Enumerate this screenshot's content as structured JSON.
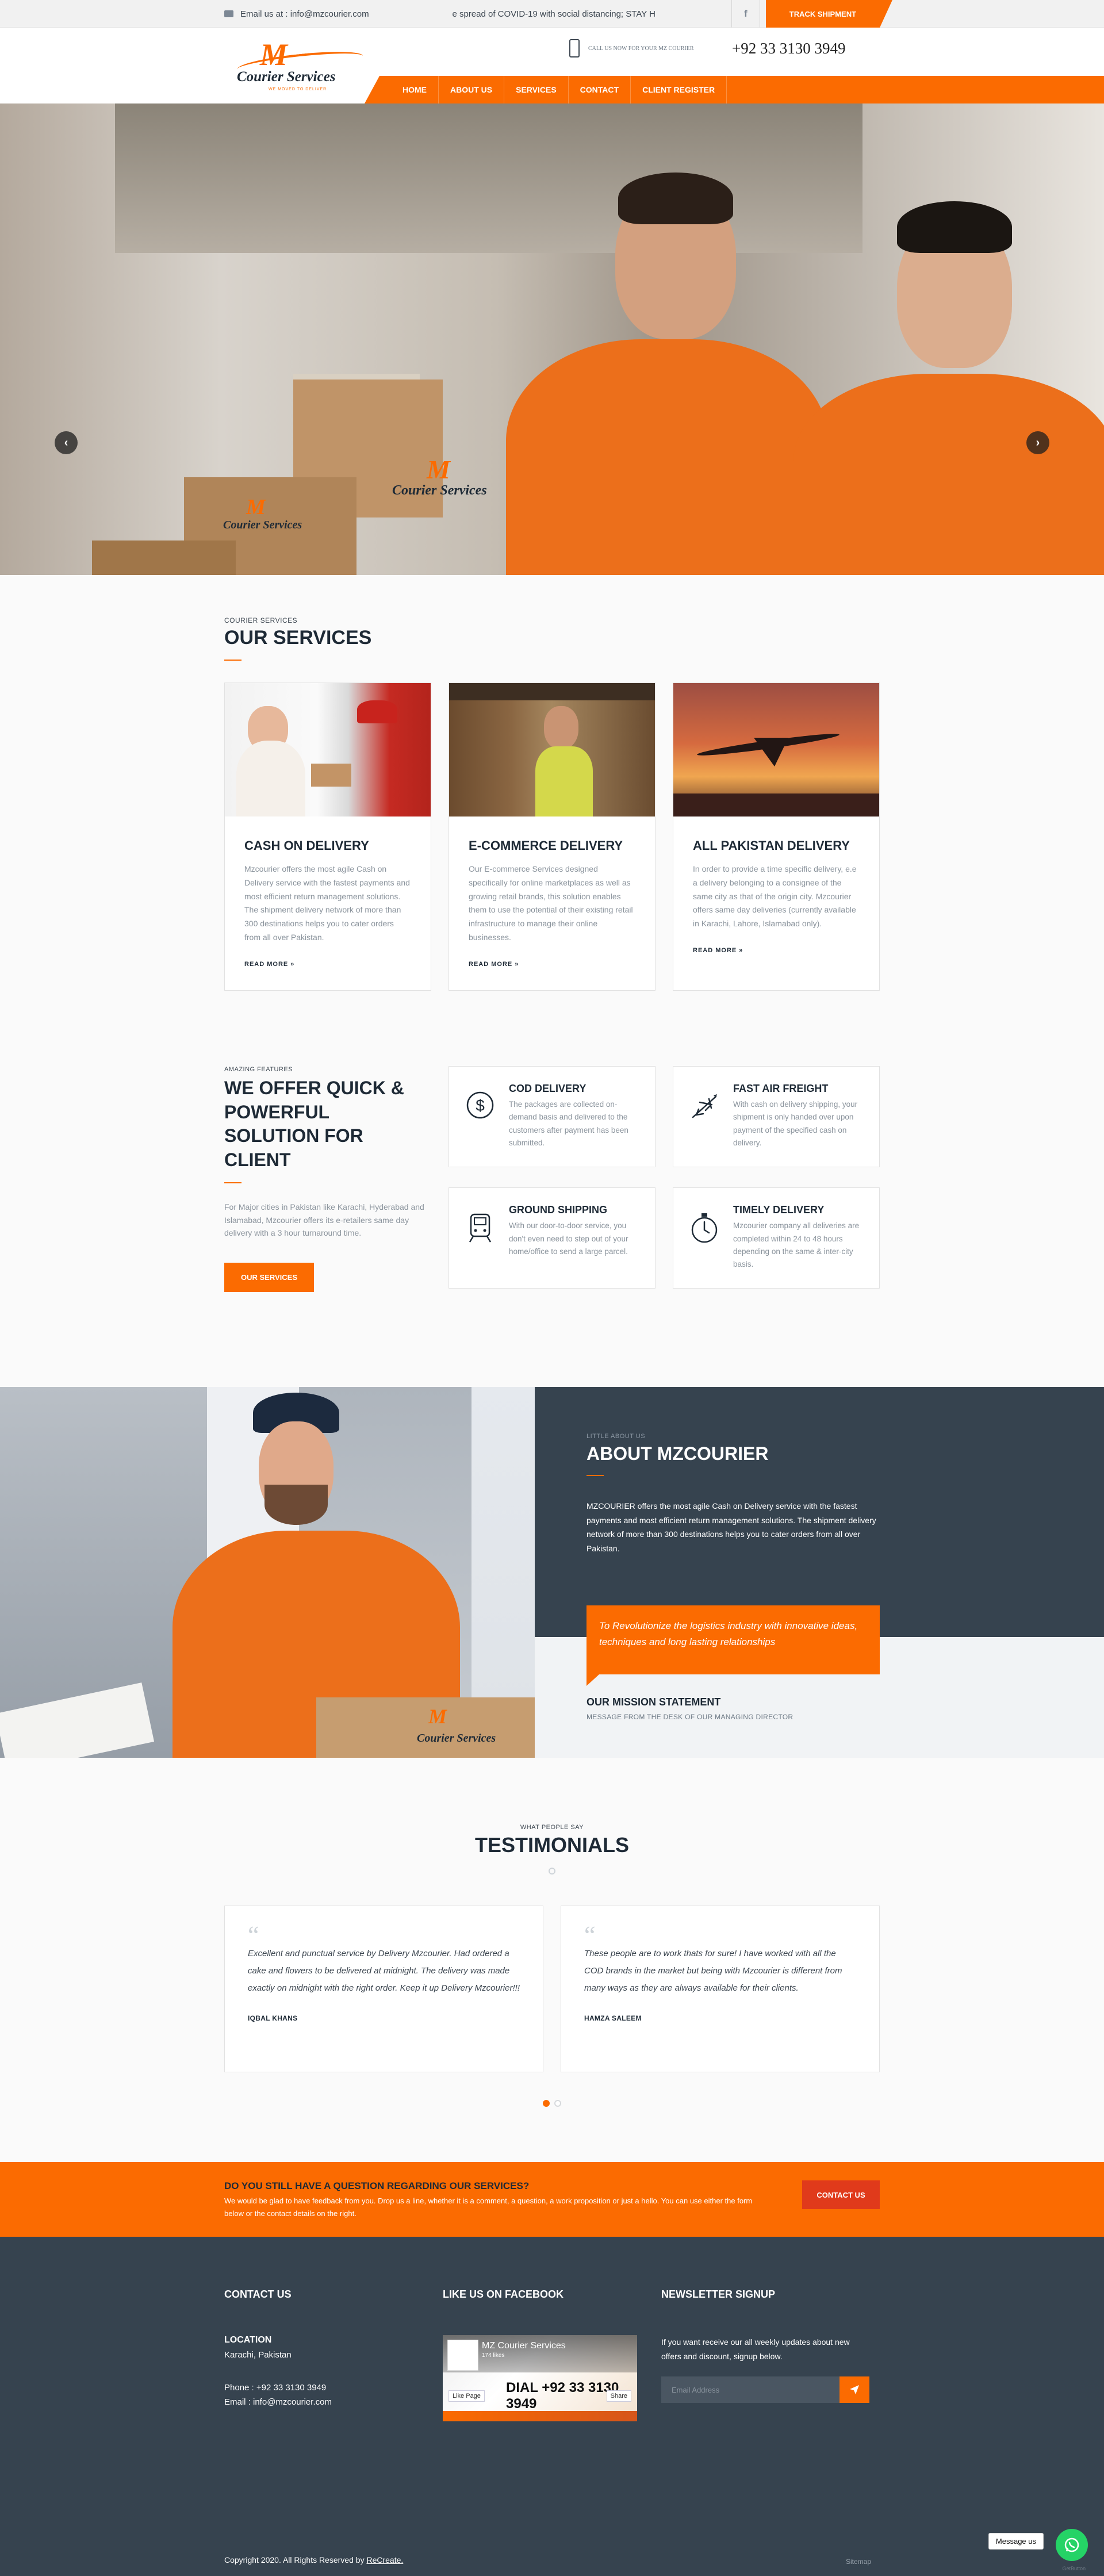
{
  "topbar": {
    "email": "Email us at : info@mzcourier.com",
    "ticker": "e spread of COVID-19 with social distancing; STAY H",
    "facebook": "f",
    "track": "TRACK SHIPMENT"
  },
  "header": {
    "logo_mark": "M",
    "logo_name": "Courier Services",
    "logo_tag": "WE MOVED TO DELIVER",
    "call_text": "CALL US NOW FOR YOUR MZ COURIER",
    "phone": "+92 33 3130 3949",
    "nav": [
      "HOME",
      "ABOUT US",
      "SERVICES",
      "CONTACT",
      "CLIENT REGISTER"
    ]
  },
  "hero": {
    "prev": "‹",
    "next": "›",
    "overlay_mark": "M",
    "overlay_name": "Courier Services"
  },
  "services": {
    "kicker": "COURIER SERVICES",
    "title": "OUR SERVICES",
    "cards": [
      {
        "title": "CASH ON DELIVERY",
        "text": "Mzcourier offers the most agile Cash on Delivery service with the fastest payments and most efficient return management solutions. The shipment delivery network of more than 300 destinations helps you to cater orders from all over Pakistan.",
        "more": "READ MORE  »"
      },
      {
        "title": "E-COMMERCE DELIVERY",
        "text": "Our E-commerce Services designed specifically for online marketplaces as well as growing retail brands, this solution enables them to use the potential of their existing retail infrastructure to manage their online businesses.",
        "more": "READ MORE  »"
      },
      {
        "title": "ALL PAKISTAN DELIVERY",
        "text": "In order to provide a time specific delivery, e.e a delivery belonging to a consignee of the same city as that of the origin city. Mzcourier offers same day deliveries (currently available in Karachi, Lahore, Islamabad only).",
        "more": "READ MORE  »"
      }
    ]
  },
  "features": {
    "kicker": "AMAZING FEATURES",
    "title": "WE OFFER QUICK & POWERFUL SOLUTION FOR CLIENT",
    "text": "For Major cities in Pakistan like Karachi, Hyderabad and Islamabad, Mzcourier offers its e-retailers same day delivery with a 3 hour turnaround time.",
    "button": "OUR SERVICES",
    "items": [
      {
        "title": "COD DELIVERY",
        "text": "The packages are collected on-demand basis and delivered to the customers after payment has been submitted.",
        "icon": "dollar-icon"
      },
      {
        "title": "FAST AIR FREIGHT",
        "text": "With cash on delivery shipping, your shipment is only handed over upon payment of the specified cash on delivery.",
        "icon": "plane-icon"
      },
      {
        "title": "GROUND SHIPPING",
        "text": "With our door-to-door service, you don't even need to step out of your home/office to send a large parcel.",
        "icon": "train-icon"
      },
      {
        "title": "TIMELY DELIVERY",
        "text": "Mzcourier company all deliveries are completed within 24 to 48 hours depending on the same & inter-city basis.",
        "icon": "stopwatch-icon"
      }
    ]
  },
  "about": {
    "kicker": "LITTLE ABOUT US",
    "title": "ABOUT MZCOURIER",
    "text": "MZCOURIER offers the most agile Cash on Delivery service with the fastest payments and most efficient return management solutions. The shipment delivery network of more than 300 destinations helps you to cater orders from all over Pakistan.",
    "quote": "To Revolutionize the logistics industry with innovative ideas, techniques and long lasting relationships",
    "mission_title": "OUR MISSION STATEMENT",
    "mission_sub": "MESSAGE FROM THE DESK OF OUR MANAGING DIRECTOR",
    "photo_mark": "M",
    "photo_name": "Courier Services"
  },
  "testimonials": {
    "kicker": "WHAT PEOPLE SAY",
    "title": "TESTIMONIALS",
    "items": [
      {
        "text": "Excellent and punctual service by Delivery Mzcourier. Had ordered a cake and flowers to be delivered at midnight. The delivery was made exactly on midnight with the right order. Keep it up Delivery Mzcourier!!!",
        "name": "IQBAL KHANS"
      },
      {
        "text": "These people are to work thats for sure! I have worked with all the COD brands in the market but being with Mzcourier is different from many ways as they are always available for their clients.",
        "name": "HAMZA SALEEM"
      }
    ]
  },
  "cta": {
    "title": "DO YOU STILL HAVE A QUESTION REGARDING OUR SERVICES?",
    "text": "We would be glad to have feedback from you. Drop us a line, whether it is a comment, a question, a work proposition or just a hello. You can use either the form below or the contact details on the right.",
    "button": "CONTACT US"
  },
  "footer": {
    "contact_title": "CONTACT US",
    "location_title": "LOCATION",
    "location": "Karachi, Pakistan",
    "phone": "Phone : +92 33 3130 3949",
    "email": "Email : info@mzcourier.com",
    "fb_title": "LIKE US ON FACEBOOK",
    "fb_name": "MZ Courier Services",
    "fb_likes": "174 likes",
    "fb_like": "Like Page",
    "fb_share": "Share",
    "fb_dial": "DIAL +92 33 3130 3949",
    "nl_title": "NEWSLETTER SIGNUP",
    "nl_text": "If you want receive our all weekly updates about new offers and discount, signup below.",
    "nl_placeholder": "Email Address",
    "copyright": "Copyright 2020. All Rights Reserved by ",
    "copyright_link": "ReCreate.",
    "sitemap": "Sitemap",
    "message_us": "Message us",
    "getbutton": "GetButton"
  },
  "colors": {
    "accent": "#fb6b01",
    "dark": "#36434f",
    "cta_button": "#e03a1b",
    "whatsapp": "#25d366"
  }
}
